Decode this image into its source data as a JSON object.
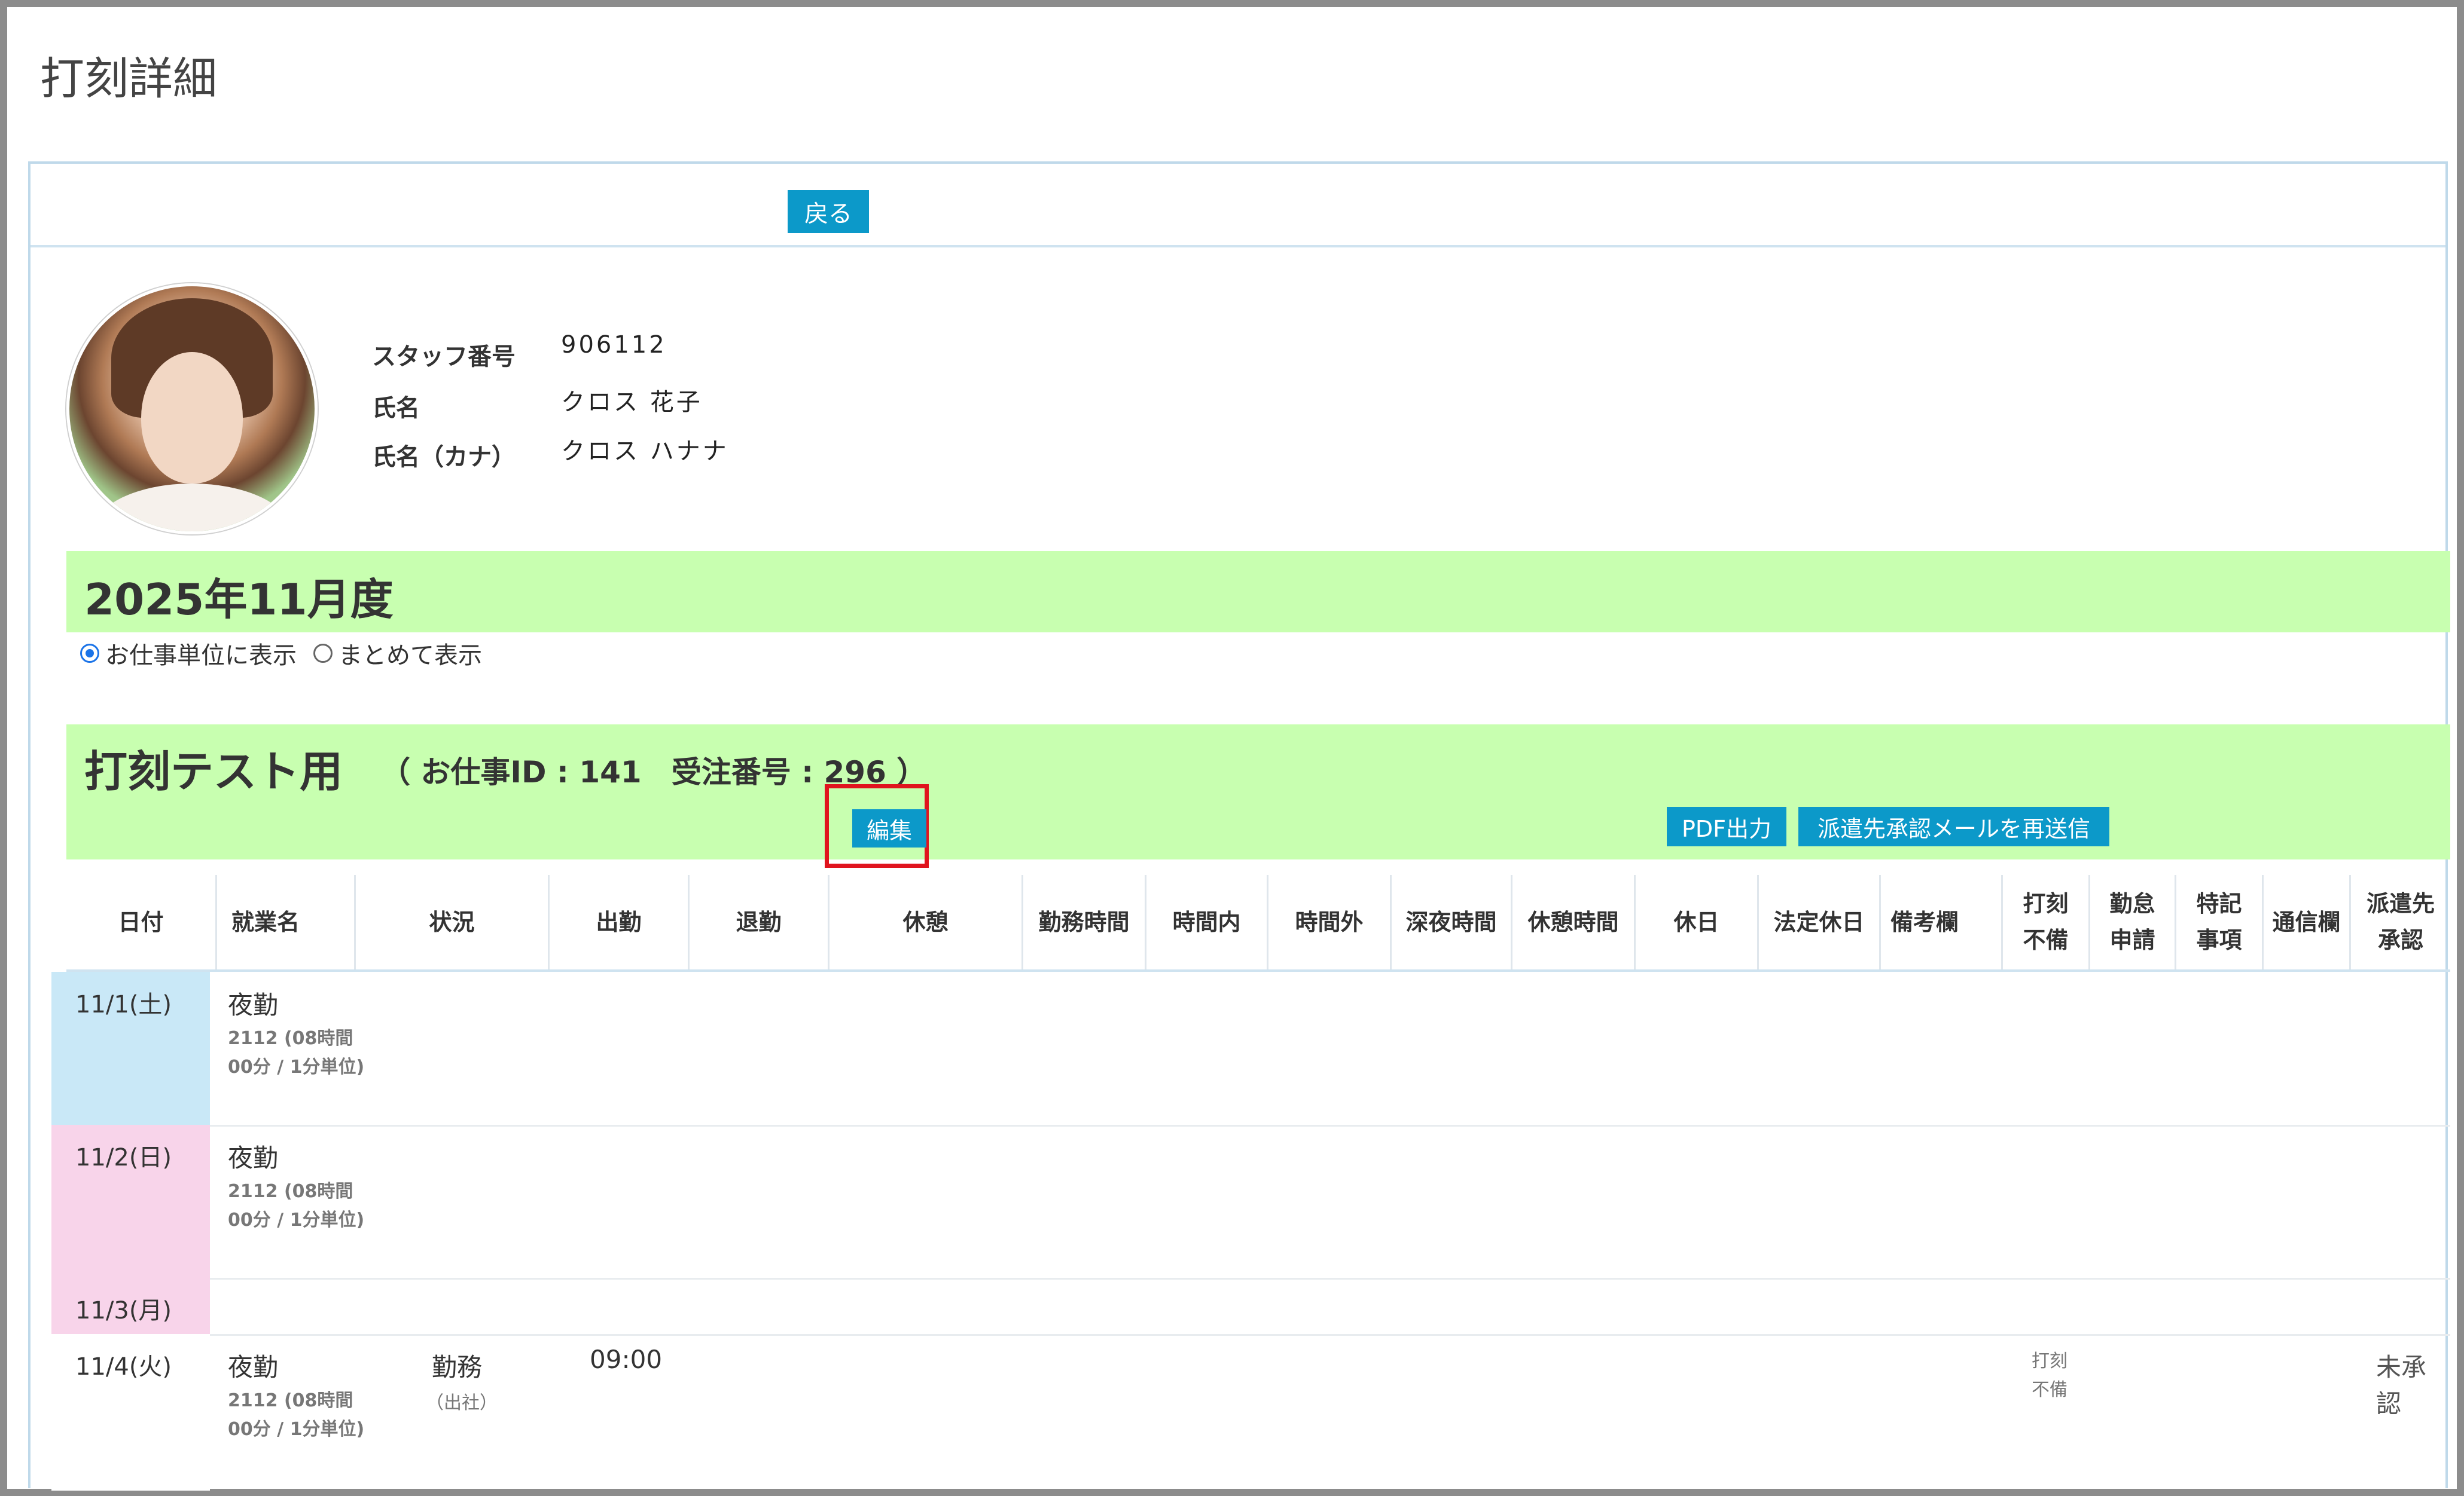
{
  "page": {
    "title": "打刻詳細"
  },
  "topbar": {
    "back_label": "戻る"
  },
  "staff": {
    "labels": {
      "number": "スタッフ番号",
      "name": "氏名",
      "kana": "氏名（カナ）"
    },
    "number": "906112",
    "name": "クロス 花子",
    "kana": "クロス ハナナ"
  },
  "month": {
    "title": "2025年11月度"
  },
  "view_mode": {
    "options": [
      "お仕事単位に表示",
      "まとめて表示"
    ],
    "selected": "お仕事単位に表示"
  },
  "job": {
    "title": "打刻テスト用",
    "meta": "（ お仕事ID : 141　受注番号 : 296 ）",
    "edit_label": "編集",
    "pdf_label": "PDF出力",
    "resend_label": "派遣先承認メールを再送信"
  },
  "table": {
    "headers": [
      "日付",
      "就業名",
      "状況",
      "出勤",
      "退勤",
      "休憩",
      "勤務時間",
      "時間内",
      "時間外",
      "深夜時間",
      "休憩時間",
      "休日",
      "法定休日",
      "備考欄",
      "打刻\n不備",
      "勤怠\n申請",
      "特記\n事項",
      "通信欄",
      "派遣先\n承認"
    ],
    "rows": [
      {
        "date": "11/1(土)",
        "shift": "夜勤",
        "shift_detail": "2112 (08時間00分 / 1分単位)",
        "day_color": "#c9e8f7"
      },
      {
        "date": "11/2(日)",
        "shift": "夜勤",
        "shift_detail": "2112 (08時間00分 / 1分単位)",
        "day_color": "#f8d4ea"
      },
      {
        "date": "11/3(月)",
        "shift": "",
        "shift_detail": "",
        "day_color": "#f8d4ea"
      },
      {
        "date": "11/4(火)",
        "shift": "夜勤",
        "shift_detail": "2112 (08時間00分 / 1分単位)",
        "status": "勤務",
        "status_sub": "（出社）",
        "clock_in": "09:00",
        "punch_missing": "打刻\n不備",
        "approval": "未承認",
        "day_color": "#ffffff"
      }
    ]
  },
  "colors": {
    "accent": "#0c99c9",
    "band": "#c8ffb0",
    "highlight": "#e0141e"
  }
}
